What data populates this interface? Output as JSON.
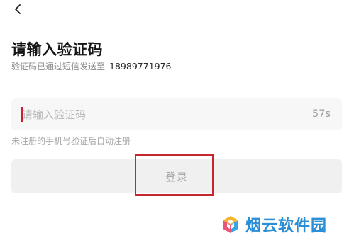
{
  "nav": {
    "back_icon": "chevron-left-icon"
  },
  "page": {
    "title": "请输入验证码",
    "sent_hint_prefix": "验证码已通过短信发送至",
    "phone_number": "18989771976"
  },
  "code_input": {
    "placeholder": "请输入验证码",
    "value": "",
    "countdown": "57s"
  },
  "auto_register_note": "未注册的手机号验证后自动注册",
  "login_button": {
    "label": "登录"
  },
  "watermark": {
    "text": "烟云软件园",
    "logo_icon": "cube-logo-icon"
  },
  "colors": {
    "caret": "#c81e2d",
    "highlight": "#c4282e",
    "watermark": "#2c8fd6",
    "button_bg": "#f0f0f0",
    "field_bg": "#f7f7f7"
  }
}
